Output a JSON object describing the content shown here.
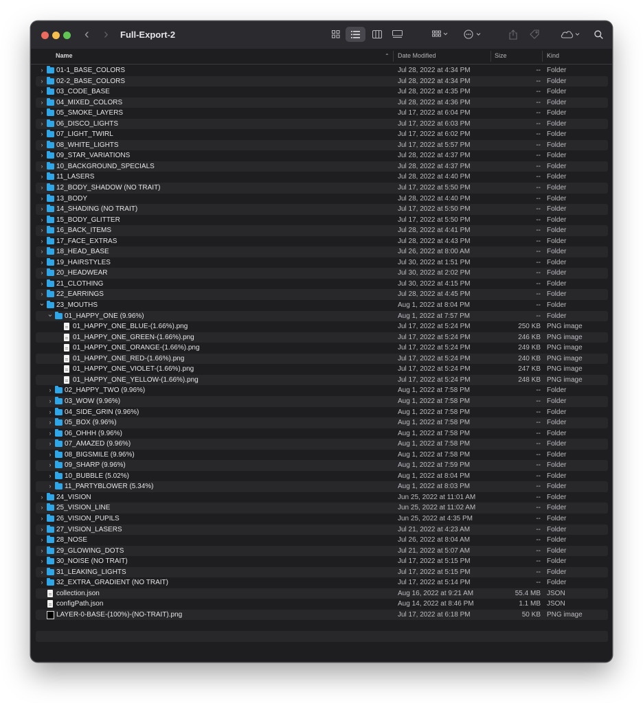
{
  "window": {
    "title": "Full-Export-2"
  },
  "columns": {
    "name": "Name",
    "date": "Date Modified",
    "size": "Size",
    "kind": "Kind"
  },
  "icons": [
    "back-icon",
    "forward-icon",
    "icon-view-icon",
    "list-view-icon",
    "column-view-icon",
    "gallery-view-icon",
    "group-icon",
    "action-icon",
    "share-icon",
    "tag-icon",
    "cloud-icon",
    "search-icon"
  ],
  "rows": [
    {
      "level": 0,
      "type": "folder",
      "open": false,
      "name": "01-1_BASE_COLORS",
      "date": "Jul 28, 2022 at 4:34 PM",
      "size": "--",
      "kind": "Folder"
    },
    {
      "level": 0,
      "type": "folder",
      "open": false,
      "name": "02-2_BASE_COLORS",
      "date": "Jul 28, 2022 at 4:34 PM",
      "size": "--",
      "kind": "Folder"
    },
    {
      "level": 0,
      "type": "folder",
      "open": false,
      "name": "03_CODE_BASE",
      "date": "Jul 28, 2022 at 4:35 PM",
      "size": "--",
      "kind": "Folder"
    },
    {
      "level": 0,
      "type": "folder",
      "open": false,
      "name": "04_MIXED_COLORS",
      "date": "Jul 28, 2022 at 4:36 PM",
      "size": "--",
      "kind": "Folder"
    },
    {
      "level": 0,
      "type": "folder",
      "open": false,
      "name": "05_SMOKE_LAYERS",
      "date": "Jul 17, 2022 at 6:04 PM",
      "size": "--",
      "kind": "Folder"
    },
    {
      "level": 0,
      "type": "folder",
      "open": false,
      "name": "06_DISCO_LIGHTS",
      "date": "Jul 17, 2022 at 6:03 PM",
      "size": "--",
      "kind": "Folder"
    },
    {
      "level": 0,
      "type": "folder",
      "open": false,
      "name": "07_LIGHT_TWIRL",
      "date": "Jul 17, 2022 at 6:02 PM",
      "size": "--",
      "kind": "Folder"
    },
    {
      "level": 0,
      "type": "folder",
      "open": false,
      "name": "08_WHITE_LIGHTS",
      "date": "Jul 17, 2022 at 5:57 PM",
      "size": "--",
      "kind": "Folder"
    },
    {
      "level": 0,
      "type": "folder",
      "open": false,
      "name": "09_STAR_VARIATIONS",
      "date": "Jul 28, 2022 at 4:37 PM",
      "size": "--",
      "kind": "Folder"
    },
    {
      "level": 0,
      "type": "folder",
      "open": false,
      "name": "10_BACKGROUND_SPECIALS",
      "date": "Jul 28, 2022 at 4:37 PM",
      "size": "--",
      "kind": "Folder"
    },
    {
      "level": 0,
      "type": "folder",
      "open": false,
      "name": "11_LASERS",
      "date": "Jul 28, 2022 at 4:40 PM",
      "size": "--",
      "kind": "Folder"
    },
    {
      "level": 0,
      "type": "folder",
      "open": false,
      "name": "12_BODY_SHADOW (NO TRAIT)",
      "date": "Jul 17, 2022 at 5:50 PM",
      "size": "--",
      "kind": "Folder"
    },
    {
      "level": 0,
      "type": "folder",
      "open": false,
      "name": "13_BODY",
      "date": "Jul 28, 2022 at 4:40 PM",
      "size": "--",
      "kind": "Folder"
    },
    {
      "level": 0,
      "type": "folder",
      "open": false,
      "name": "14_SHADING (NO TRAIT)",
      "date": "Jul 17, 2022 at 5:50 PM",
      "size": "--",
      "kind": "Folder"
    },
    {
      "level": 0,
      "type": "folder",
      "open": false,
      "name": "15_BODY_GLITTER",
      "date": "Jul 17, 2022 at 5:50 PM",
      "size": "--",
      "kind": "Folder"
    },
    {
      "level": 0,
      "type": "folder",
      "open": false,
      "name": "16_BACK_ITEMS",
      "date": "Jul 28, 2022 at 4:41 PM",
      "size": "--",
      "kind": "Folder"
    },
    {
      "level": 0,
      "type": "folder",
      "open": false,
      "name": "17_FACE_EXTRAS",
      "date": "Jul 28, 2022 at 4:43 PM",
      "size": "--",
      "kind": "Folder"
    },
    {
      "level": 0,
      "type": "folder",
      "open": false,
      "name": "18_HEAD_BASE",
      "date": "Jul 26, 2022 at 8:00 AM",
      "size": "--",
      "kind": "Folder"
    },
    {
      "level": 0,
      "type": "folder",
      "open": false,
      "name": "19_HAIRSTYLES",
      "date": "Jul 30, 2022 at 1:51 PM",
      "size": "--",
      "kind": "Folder"
    },
    {
      "level": 0,
      "type": "folder",
      "open": false,
      "name": "20_HEADWEAR",
      "date": "Jul 30, 2022 at 2:02 PM",
      "size": "--",
      "kind": "Folder"
    },
    {
      "level": 0,
      "type": "folder",
      "open": false,
      "name": "21_CLOTHING",
      "date": "Jul 30, 2022 at 4:15 PM",
      "size": "--",
      "kind": "Folder"
    },
    {
      "level": 0,
      "type": "folder",
      "open": false,
      "name": "22_EARRINGS",
      "date": "Jul 28, 2022 at 4:45 PM",
      "size": "--",
      "kind": "Folder"
    },
    {
      "level": 0,
      "type": "folder",
      "open": true,
      "name": "23_MOUTHS",
      "date": "Aug 1, 2022 at 8:04 PM",
      "size": "--",
      "kind": "Folder"
    },
    {
      "level": 1,
      "type": "folder",
      "open": true,
      "name": "01_HAPPY_ONE (9.96%)",
      "date": "Aug 1, 2022 at 7:57 PM",
      "size": "--",
      "kind": "Folder"
    },
    {
      "level": 2,
      "type": "file",
      "name": "01_HAPPY_ONE_BLUE-(1.66%).png",
      "date": "Jul 17, 2022 at 5:24 PM",
      "size": "250 KB",
      "kind": "PNG image"
    },
    {
      "level": 2,
      "type": "file",
      "name": "01_HAPPY_ONE_GREEN-(1.66%).png",
      "date": "Jul 17, 2022 at 5:24 PM",
      "size": "246 KB",
      "kind": "PNG image"
    },
    {
      "level": 2,
      "type": "file",
      "name": "01_HAPPY_ONE_ORANGE-(1.66%).png",
      "date": "Jul 17, 2022 at 5:24 PM",
      "size": "249 KB",
      "kind": "PNG image"
    },
    {
      "level": 2,
      "type": "file",
      "name": "01_HAPPY_ONE_RED-(1.66%).png",
      "date": "Jul 17, 2022 at 5:24 PM",
      "size": "240 KB",
      "kind": "PNG image"
    },
    {
      "level": 2,
      "type": "file",
      "name": "01_HAPPY_ONE_VIOLET-(1.66%).png",
      "date": "Jul 17, 2022 at 5:24 PM",
      "size": "247 KB",
      "kind": "PNG image"
    },
    {
      "level": 2,
      "type": "file",
      "name": "01_HAPPY_ONE_YELLOW-(1.66%).png",
      "date": "Jul 17, 2022 at 5:24 PM",
      "size": "248 KB",
      "kind": "PNG image"
    },
    {
      "level": 1,
      "type": "folder",
      "open": false,
      "name": "02_HAPPY_TWO (9.96%)",
      "date": "Aug 1, 2022 at 7:58 PM",
      "size": "--",
      "kind": "Folder"
    },
    {
      "level": 1,
      "type": "folder",
      "open": false,
      "name": "03_WOW  (9.96%)",
      "date": "Aug 1, 2022 at 7:58 PM",
      "size": "--",
      "kind": "Folder"
    },
    {
      "level": 1,
      "type": "folder",
      "open": false,
      "name": "04_SIDE_GRIN  (9.96%)",
      "date": "Aug 1, 2022 at 7:58 PM",
      "size": "--",
      "kind": "Folder"
    },
    {
      "level": 1,
      "type": "folder",
      "open": false,
      "name": "05_BOX  (9.96%)",
      "date": "Aug 1, 2022 at 7:58 PM",
      "size": "--",
      "kind": "Folder"
    },
    {
      "level": 1,
      "type": "folder",
      "open": false,
      "name": "06_OHHH  (9.96%)",
      "date": "Aug 1, 2022 at 7:58 PM",
      "size": "--",
      "kind": "Folder"
    },
    {
      "level": 1,
      "type": "folder",
      "open": false,
      "name": "07_AMAZED  (9.96%)",
      "date": "Aug 1, 2022 at 7:58 PM",
      "size": "--",
      "kind": "Folder"
    },
    {
      "level": 1,
      "type": "folder",
      "open": false,
      "name": "08_BIGSMILE  (9.96%)",
      "date": "Aug 1, 2022 at 7:58 PM",
      "size": "--",
      "kind": "Folder"
    },
    {
      "level": 1,
      "type": "folder",
      "open": false,
      "name": "09_SHARP  (9.96%)",
      "date": "Aug 1, 2022 at 7:59 PM",
      "size": "--",
      "kind": "Folder"
    },
    {
      "level": 1,
      "type": "folder",
      "open": false,
      "name": "10_BUBBLE  (5.02%)",
      "date": "Aug 1, 2022 at 8:04 PM",
      "size": "--",
      "kind": "Folder"
    },
    {
      "level": 1,
      "type": "folder",
      "open": false,
      "name": "11_PARTYBLOWER (5.34%)",
      "date": "Aug 1, 2022 at 8:03 PM",
      "size": "--",
      "kind": "Folder"
    },
    {
      "level": 0,
      "type": "folder",
      "open": false,
      "name": "24_VISION",
      "date": "Jun 25, 2022 at 11:01 AM",
      "size": "--",
      "kind": "Folder"
    },
    {
      "level": 0,
      "type": "folder",
      "open": false,
      "name": "25_VISION_LINE",
      "date": "Jun 25, 2022 at 11:02 AM",
      "size": "--",
      "kind": "Folder"
    },
    {
      "level": 0,
      "type": "folder",
      "open": false,
      "name": "26_VISION_PUPILS",
      "date": "Jun 25, 2022 at 4:35 PM",
      "size": "--",
      "kind": "Folder"
    },
    {
      "level": 0,
      "type": "folder",
      "open": false,
      "name": "27_VISION_LASERS",
      "date": "Jul 21, 2022 at 4:23 AM",
      "size": "--",
      "kind": "Folder"
    },
    {
      "level": 0,
      "type": "folder",
      "open": false,
      "name": "28_NOSE",
      "date": "Jul 26, 2022 at 8:04 AM",
      "size": "--",
      "kind": "Folder"
    },
    {
      "level": 0,
      "type": "folder",
      "open": false,
      "name": "29_GLOWING_DOTS",
      "date": "Jul 21, 2022 at 5:07 AM",
      "size": "--",
      "kind": "Folder"
    },
    {
      "level": 0,
      "type": "folder",
      "open": false,
      "name": "30_NOISE (NO TRAIT)",
      "date": "Jul 17, 2022 at 5:15 PM",
      "size": "--",
      "kind": "Folder"
    },
    {
      "level": 0,
      "type": "folder",
      "open": false,
      "name": "31_LEAKING_LIGHTS",
      "date": "Jul 17, 2022 at 5:15 PM",
      "size": "--",
      "kind": "Folder"
    },
    {
      "level": 0,
      "type": "folder",
      "open": false,
      "name": "32_EXTRA_GRADIENT (NO TRAIT)",
      "date": "Jul 17, 2022 at 5:14 PM",
      "size": "--",
      "kind": "Folder"
    },
    {
      "level": 0,
      "type": "file",
      "name": "collection.json",
      "date": "Aug 16, 2022 at 9:21 AM",
      "size": "55.4 MB",
      "kind": "JSON"
    },
    {
      "level": 0,
      "type": "file",
      "name": "configPath.json",
      "date": "Aug 14, 2022 at 8:46 PM",
      "size": "1.1 MB",
      "kind": "JSON"
    },
    {
      "level": 0,
      "type": "image",
      "name": "LAYER-0-BASE-(100%)-(NO-TRAIT).png",
      "date": "Jul 17, 2022 at 6:18 PM",
      "size": "50 KB",
      "kind": "PNG image"
    }
  ]
}
